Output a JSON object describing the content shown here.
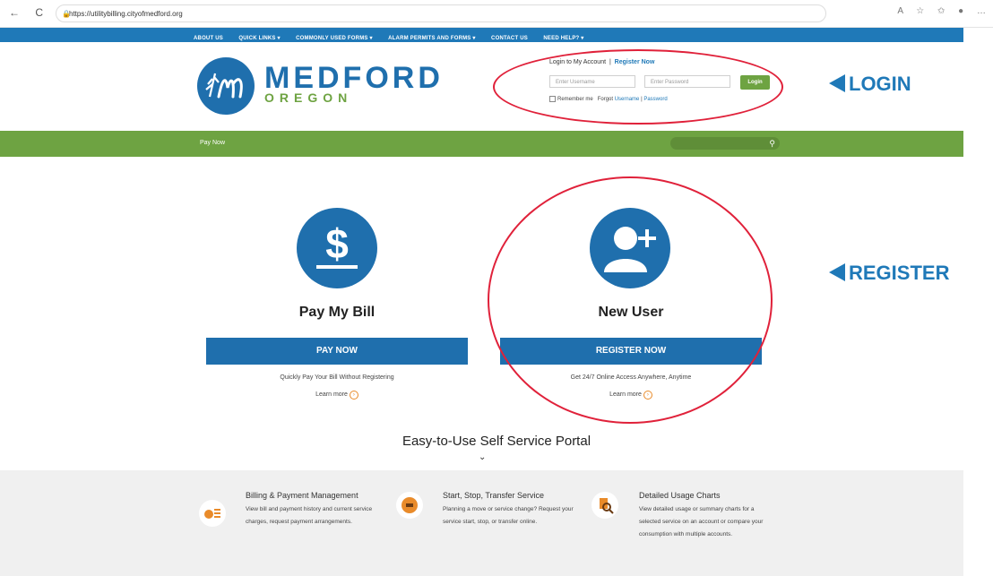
{
  "browser": {
    "url": "https://utilitybilling.cityofmedford.org"
  },
  "topnav": {
    "items": [
      "ABOUT US",
      "QUICK LINKS ▾",
      "COMMONLY USED FORMS ▾",
      "ALARM PERMITS AND FORMS ▾",
      "CONTACT US",
      "NEED HELP? ▾"
    ]
  },
  "logo": {
    "name": "MEDFORD",
    "sub": "OREGON"
  },
  "login": {
    "title": "Login to My Account",
    "separator": "|",
    "register_link": "Register Now",
    "username_placeholder": "Enter Username",
    "password_placeholder": "Enter Password",
    "login_button": "Login",
    "remember_label": "Remember me",
    "forgot_label": "Forgot",
    "forgot_username": "Username",
    "forgot_sep": "|",
    "forgot_password": "Password"
  },
  "greenbar": {
    "paynow_link": "Pay Now"
  },
  "callouts": {
    "login": "LOGIN",
    "register": "REGISTER"
  },
  "cards": {
    "pay": {
      "title": "Pay My Bill",
      "button": "PAY NOW",
      "desc": "Quickly Pay Your Bill Without Registering",
      "learn": "Learn more"
    },
    "new_user": {
      "title": "New User",
      "button": "REGISTER NOW",
      "desc": "Get 24/7 Online Access Anywhere, Anytime",
      "learn": "Learn more"
    }
  },
  "portal": {
    "title": "Easy-to-Use Self Service Portal"
  },
  "features": [
    {
      "title": "Billing & Payment Management",
      "desc": "View bill and payment history and current service charges, request payment arrangements."
    },
    {
      "title": "Start, Stop, Transfer Service",
      "desc": "Planning a move or service change? Request your service start, stop, or transfer online."
    },
    {
      "title": "Detailed Usage Charts",
      "desc": "View detailed usage or summary charts for a selected service on an account or compare your consumption with multiple accounts."
    }
  ],
  "colors": {
    "blue": "#1f6fad",
    "green": "#6ea342",
    "annotation_red": "#e0213a"
  }
}
